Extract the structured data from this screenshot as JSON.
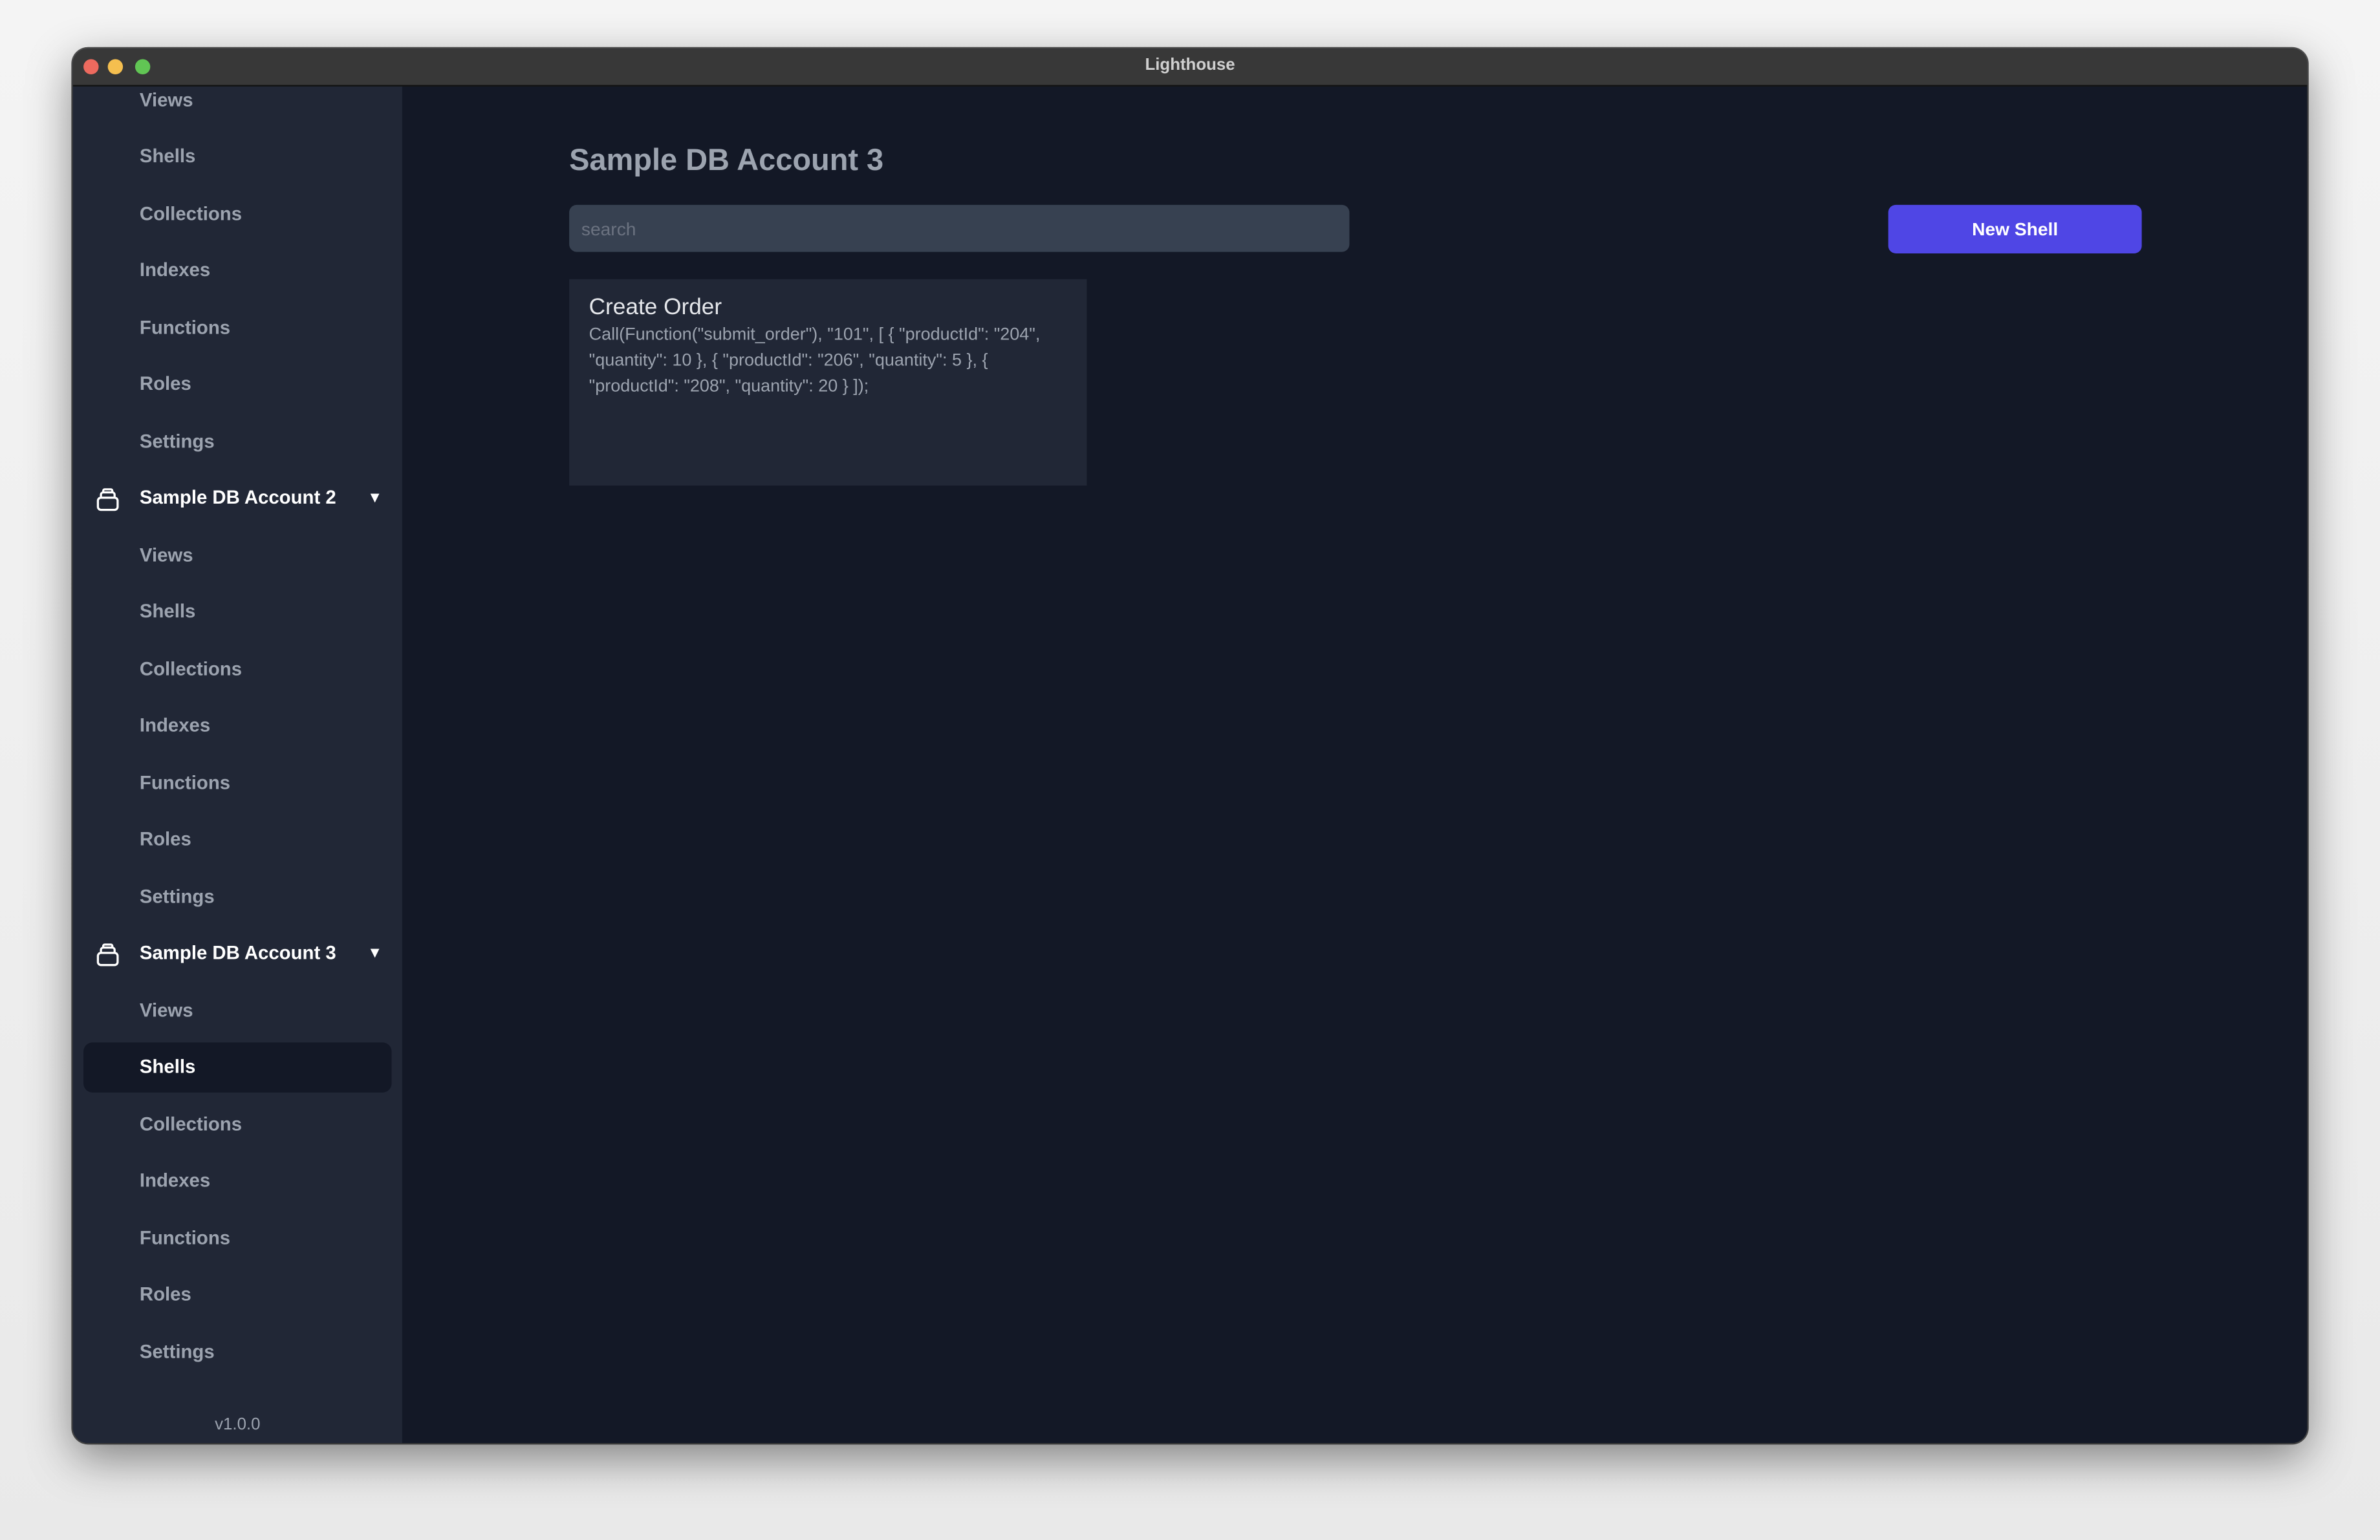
{
  "window": {
    "title": "Lighthouse",
    "traffic_lights": [
      "#ed6a5e",
      "#f5bf4f",
      "#61c554"
    ]
  },
  "sidebar": {
    "top_items": [
      "Views",
      "Shells",
      "Collections",
      "Indexes",
      "Functions",
      "Roles",
      "Settings"
    ],
    "accounts": [
      {
        "name": "Sample DB Account 2",
        "expanded": true,
        "items": [
          "Views",
          "Shells",
          "Collections",
          "Indexes",
          "Functions",
          "Roles",
          "Settings"
        ]
      },
      {
        "name": "Sample DB Account 3",
        "expanded": true,
        "selected": "Shells",
        "items": [
          "Views",
          "Shells",
          "Collections",
          "Indexes",
          "Functions",
          "Roles",
          "Settings"
        ]
      }
    ],
    "version": "v1.0.0"
  },
  "main": {
    "title": "Sample DB Account 3",
    "search": {
      "placeholder": "search",
      "value": ""
    },
    "new_button": "New Shell",
    "accent": "#4f46e5",
    "shells": [
      {
        "title": "Create Order",
        "code": "Call(Function(\"submit_order\"), \"101\", [ { \"productId\": \"204\", \"quantity\": 10 }, { \"productId\": \"206\", \"quantity\": 5 }, { \"productId\": \"208\", \"quantity\": 20 } ]);"
      }
    ]
  }
}
